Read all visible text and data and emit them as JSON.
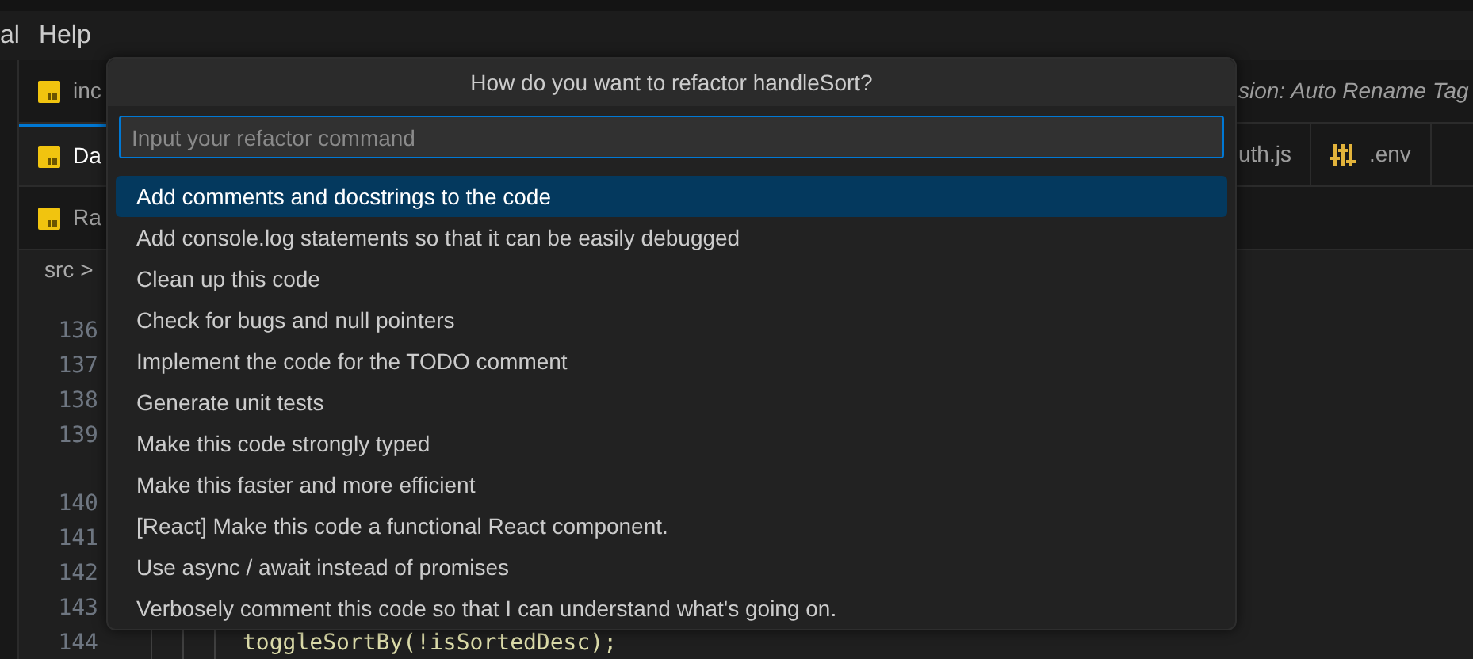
{
  "menu_bar": {
    "items": [
      "al",
      "Help"
    ]
  },
  "tab_rows": [
    {
      "left": [
        {
          "label": "inc",
          "kind": "js",
          "selected": false
        }
      ],
      "right": [
        {
          "label": "sion: Auto Rename Tag",
          "kind": "plain",
          "italic": true,
          "selected": false
        }
      ]
    },
    {
      "left": [
        {
          "label": "Da",
          "kind": "js",
          "selected": true
        }
      ],
      "right": [
        {
          "label": "uth.js",
          "kind": "plain",
          "italic": false,
          "selected": false
        },
        {
          "label": ".env",
          "kind": "settings",
          "italic": false,
          "selected": false
        }
      ]
    },
    {
      "left": [
        {
          "label": "Ra",
          "kind": "js",
          "selected": false
        }
      ],
      "right": []
    }
  ],
  "breadcrumb": {
    "segment": "src",
    "separator": ">"
  },
  "editor": {
    "line_groups": [
      [
        "136",
        "137",
        "138",
        "139"
      ],
      [
        "140",
        "141",
        "142",
        "143",
        "144"
      ]
    ],
    "last_line_code": "toggleSortBy(!isSortedDesc);"
  },
  "quick_pick": {
    "title": "How do you want to refactor handleSort?",
    "placeholder": "Input your refactor command",
    "items": [
      {
        "label": "Add comments and docstrings to the code",
        "selected": true
      },
      {
        "label": "Add console.log statements so that it can be easily debugged",
        "selected": false
      },
      {
        "label": "Clean up this code",
        "selected": false
      },
      {
        "label": "Check for bugs and null pointers",
        "selected": false
      },
      {
        "label": "Implement the code for the TODO comment",
        "selected": false
      },
      {
        "label": "Generate unit tests",
        "selected": false
      },
      {
        "label": "Make this code strongly typed",
        "selected": false
      },
      {
        "label": "Make this faster and more efficient",
        "selected": false
      },
      {
        "label": "[React] Make this code a functional React component.",
        "selected": false
      },
      {
        "label": "Use async / await instead of promises",
        "selected": false
      },
      {
        "label": "Verbosely comment this code so that I can understand what's going on.",
        "selected": false
      }
    ]
  }
}
